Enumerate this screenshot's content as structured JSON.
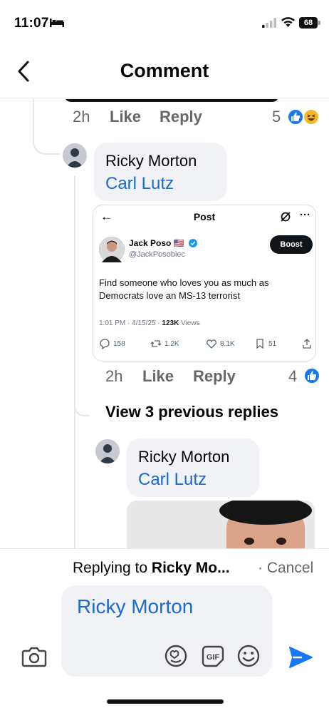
{
  "status_bar": {
    "time": "11:07",
    "battery": "68"
  },
  "header": {
    "title": "Comment"
  },
  "first_comment": {
    "time": "2h",
    "like": "Like",
    "reply": "Reply",
    "reaction_count": "5"
  },
  "second_comment": {
    "author": "Ricky Morton",
    "mention": "Carl Lutz",
    "time": "2h",
    "like": "Like",
    "reply": "Reply",
    "reaction_count": "4"
  },
  "tweet": {
    "header": "Post",
    "name": "Jack Poso 🇺🇸",
    "handle": "@JackPosobiec",
    "boost": "Boost",
    "text": "Find someone who loves you as much as Democrats love an MS-13 terrorist",
    "meta_time": "1:01 PM · 4/15/25 · ",
    "meta_views": "123K",
    "meta_views_label": " Views",
    "stats": {
      "replies": "158",
      "reposts": "1.2K",
      "likes": "8.1K",
      "bookmarks": "51"
    }
  },
  "view_previous": "View 3 previous replies",
  "third_comment": {
    "author": "Ricky Morton",
    "mention": "Carl Lutz"
  },
  "reply_banner": {
    "prefix": "Replying to ",
    "name": "Ricky Mo...",
    "separator": " · ",
    "cancel": "Cancel"
  },
  "composer": {
    "value": "Ricky Morton"
  },
  "colors": {
    "link_blue": "#1b6ad2",
    "send_blue": "#1877f2",
    "bubble_bg": "#f0f2f5",
    "meta_gray": "#65676b"
  },
  "icons": [
    "back-icon",
    "like-reaction-icon",
    "haha-reaction-icon",
    "camera-icon",
    "sticker-icon",
    "gif-icon",
    "emoji-icon",
    "send-icon"
  ]
}
